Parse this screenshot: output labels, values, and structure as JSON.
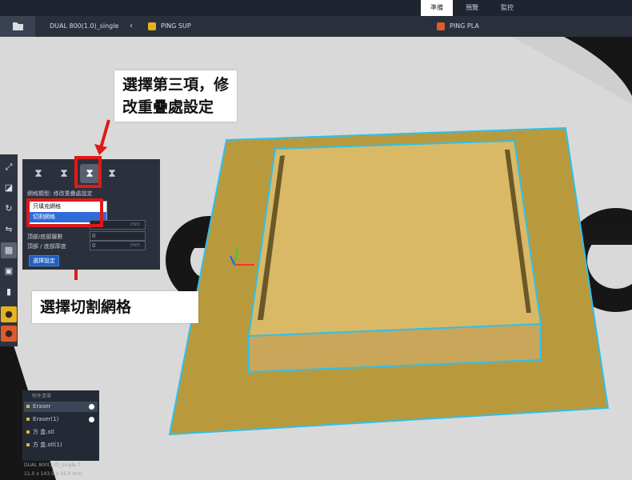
{
  "top_tabs": [
    "準備",
    "預覽",
    "監控"
  ],
  "project": {
    "name": "DUAL 800(1.0)_single",
    "chevron": "‹"
  },
  "materials": [
    {
      "label": "PING SUP",
      "color": "#e8b21f"
    },
    {
      "label": "PING PLA",
      "color": "#e05a2a"
    }
  ],
  "panel": {
    "heading": "網格類型: 修改重疊處設定",
    "dropdown_options": [
      "只填充網格",
      "切割網格"
    ],
    "fields": [
      {
        "label": "",
        "value": "",
        "unit": "mm"
      },
      {
        "label": "頂部/底部層數",
        "value": "0",
        "unit": ""
      },
      {
        "label": "頂部 / 底部厚度",
        "value": "0",
        "unit": "mm"
      }
    ],
    "select_button": "選擇設定"
  },
  "annotations": {
    "top_callout": [
      "選擇第三項，修",
      "改重疊處設定"
    ],
    "bottom_callout": "選擇切割網格"
  },
  "objects": {
    "header": "物件清單",
    "items": [
      {
        "name": "Eraser"
      },
      {
        "name": "Eraser(1)"
      },
      {
        "name": "方 盒.stl"
      },
      {
        "name": "方 盒.stl(1)"
      }
    ]
  },
  "footer": {
    "line1": "DUAL 800(1.0)_single  7",
    "line2": "11.0 x 143.5 x 15.0 mm"
  },
  "colors": {
    "plate": "#b89a3d",
    "box_top": "#d9b965",
    "box_side": "#c9a659",
    "outline": "#2fc0ea",
    "annotation_red": "#e01919",
    "selection_blue": "#2f6bd8"
  }
}
